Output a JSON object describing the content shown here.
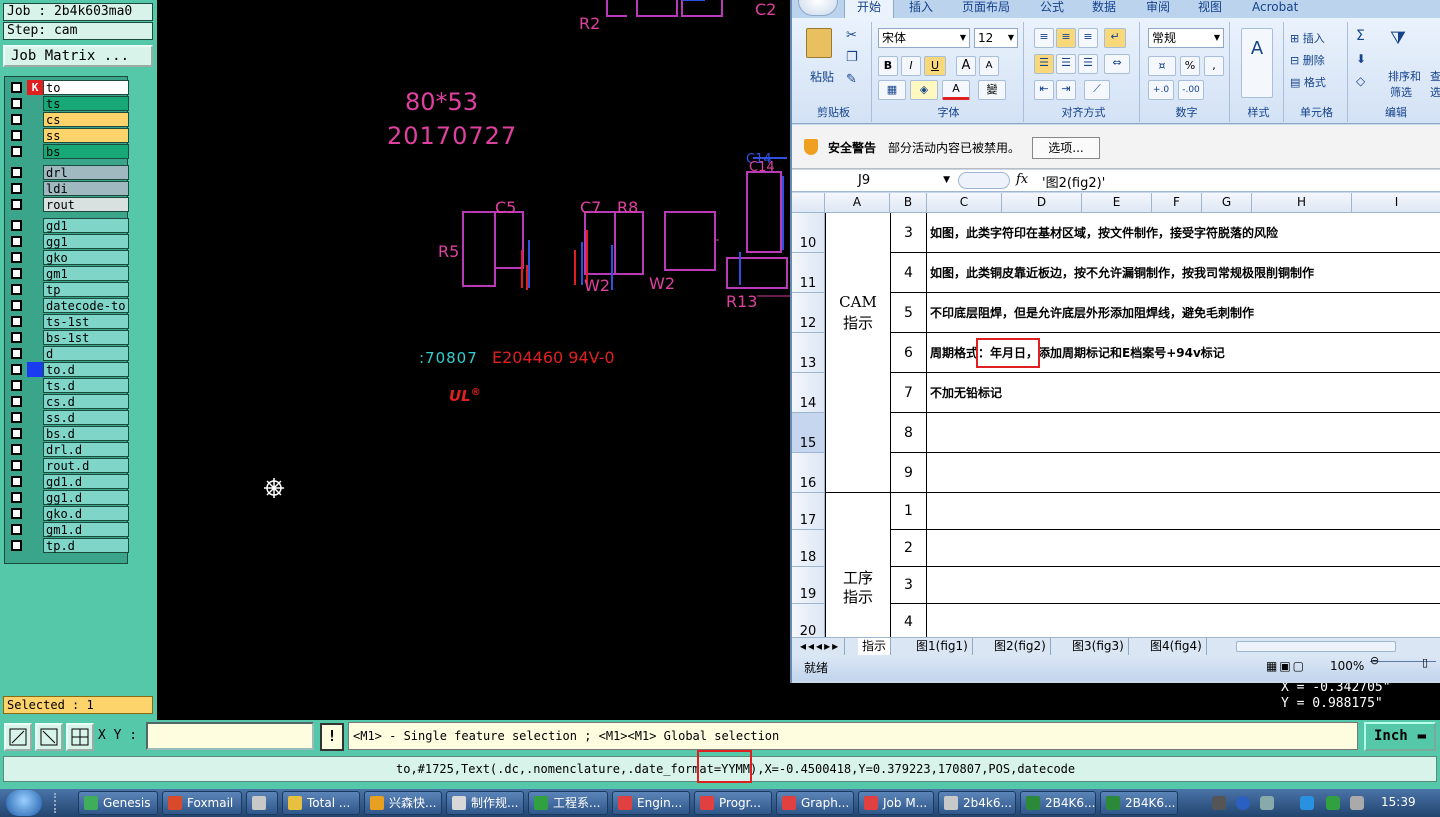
{
  "genesis": {
    "job_label": "Job : 2b4k603ma0",
    "step_label": "Step: cam",
    "job_matrix_button": "Job Matrix ...",
    "layers": [
      {
        "name": "to",
        "color": "#ffffff",
        "tag": "red-k"
      },
      {
        "name": "ts",
        "color": "#18a878"
      },
      {
        "name": "cs",
        "color": "#fdd36b"
      },
      {
        "name": "ss",
        "color": "#fdd36b"
      },
      {
        "name": "bs",
        "color": "#18a878"
      },
      {
        "name": "drl",
        "color": "#a0b8c0"
      },
      {
        "name": "ldi",
        "color": "#a0b8c0"
      },
      {
        "name": "rout",
        "color": "#d8e0e0"
      },
      {
        "name": "gd1",
        "color": "#7fd6c8"
      },
      {
        "name": "gg1",
        "color": "#7fd6c8"
      },
      {
        "name": "gko",
        "color": "#7fd6c8"
      },
      {
        "name": "gm1",
        "color": "#7fd6c8"
      },
      {
        "name": "tp",
        "color": "#7fd6c8"
      },
      {
        "name": "datecode-to",
        "color": "#7fd6c8"
      },
      {
        "name": "ts-1st",
        "color": "#7fd6c8"
      },
      {
        "name": "bs-1st",
        "color": "#7fd6c8"
      },
      {
        "name": "d",
        "color": "#7fd6c8"
      },
      {
        "name": "to.d",
        "color": "#7fd6c8",
        "tag": "blue"
      },
      {
        "name": "ts.d",
        "color": "#7fd6c8"
      },
      {
        "name": "cs.d",
        "color": "#7fd6c8"
      },
      {
        "name": "ss.d",
        "color": "#7fd6c8"
      },
      {
        "name": "bs.d",
        "color": "#7fd6c8"
      },
      {
        "name": "drl.d",
        "color": "#7fd6c8"
      },
      {
        "name": "rout.d",
        "color": "#7fd6c8"
      },
      {
        "name": "gd1.d",
        "color": "#7fd6c8"
      },
      {
        "name": "gg1.d",
        "color": "#7fd6c8"
      },
      {
        "name": "gko.d",
        "color": "#7fd6c8"
      },
      {
        "name": "gm1.d",
        "color": "#7fd6c8"
      },
      {
        "name": "tp.d",
        "color": "#7fd6c8"
      }
    ],
    "selected_label": "Selected : 1",
    "canvas": {
      "size_text": "80*53",
      "date_text": "20170727",
      "ref_labels": [
        "R2",
        "C2",
        "C5",
        "C7",
        "R8",
        "R5",
        "C14",
        "C14",
        "W2",
        "W2",
        "R13"
      ],
      "datecode_text": ":70807",
      "ul_text": "E204460 94V-0",
      "ul_mark": "UL",
      "registered_mark": "®"
    },
    "coord_x": "X = -0.342705\"",
    "coord_y": "Y =  0.988175\"",
    "xy_label": "X Y :",
    "xy_value": "",
    "warn_symbol": "!",
    "hint_text": "<M1> - Single feature selection ; <M1><M1> Global selection",
    "unit": "Inch",
    "status_text": "to,#1725,Text(.dc,.nomenclature,.date_format=YYMM),X=-0.4500418,Y=0.379223,170807,POS,datecode"
  },
  "excel": {
    "tabs": [
      "开始",
      "插入",
      "页面布局",
      "公式",
      "数据",
      "审阅",
      "视图",
      "Acrobat"
    ],
    "clipboard": {
      "paste": "粘贴",
      "label": "剪贴板"
    },
    "font": {
      "name": "宋体",
      "size": "12",
      "label": "字体",
      "bold": "B",
      "italic": "I",
      "underline": "U",
      "grow": "A",
      "shrink": "A",
      "font_color": "A",
      "phonetic": "變"
    },
    "alignment": {
      "label": "对齐方式"
    },
    "number": {
      "format": "常规",
      "label": "数字",
      "percent": "%",
      "comma": ","
    },
    "styles": {
      "label": "样式"
    },
    "cells": {
      "insert": "插入",
      "delete": "删除",
      "format": "格式",
      "label": "单元格"
    },
    "editing": {
      "sum": "Σ",
      "sort": "排序和",
      "filter": "筛选",
      "find": "查",
      "find2": "选",
      "label": "编辑"
    },
    "security": {
      "title": "安全警告",
      "message": "部分活动内容已被禁用。",
      "options_button": "选项..."
    },
    "name_box": "J9",
    "fx": "fx",
    "formula": "'图2(fig2)'",
    "columns": [
      "A",
      "B",
      "C",
      "D",
      "E",
      "F",
      "G",
      "H",
      "I"
    ],
    "rows": [
      {
        "num": "10",
        "no": "3",
        "text": "如图，此类字符印在基材区域，按文件制作，接受字符脱落的风险"
      },
      {
        "num": "11",
        "no": "4",
        "text": "如图，此类铜皮靠近板边，按不允许漏铜制作，按我司常规极限削铜制作"
      },
      {
        "num": "12",
        "no": "5",
        "text": "不印底层阻焊，但是允许底层外形添加阻焊线，避免毛刺制作"
      },
      {
        "num": "13",
        "no": "6",
        "text_pre": "周期格式",
        "highlight": "：年月日，",
        "text_post": "添加周期标记和E档案号+94v标记"
      },
      {
        "num": "14",
        "no": "7",
        "text": "不加无铅标记"
      },
      {
        "num": "15",
        "no": "8",
        "text": ""
      },
      {
        "num": "16",
        "no": "9",
        "text": ""
      },
      {
        "num": "17",
        "no": "1",
        "text": ""
      },
      {
        "num": "18",
        "no": "2",
        "text": ""
      },
      {
        "num": "19",
        "no": "3",
        "text": ""
      },
      {
        "num": "20",
        "no": "4",
        "text": ""
      }
    ],
    "group_cam_line1": "CAM",
    "group_cam_line2": "指示",
    "group_process_line1": "工序",
    "group_process_line2": "指示",
    "sheet_tabs": [
      "指示",
      "图1(fig1)",
      "图2(fig2)",
      "图3(fig3)",
      "图4(fig4)"
    ],
    "status_ready": "就绪",
    "zoom": "100%"
  },
  "taskbar": {
    "items": [
      {
        "label": "Genesis",
        "color": "#3fae5a"
      },
      {
        "label": "Foxmail",
        "color": "#d94a2a"
      },
      {
        "label": "",
        "color": "#c8c8c8"
      },
      {
        "label": "Total ...",
        "color": "#e8c040"
      },
      {
        "label": "兴森快...",
        "color": "#e8a020"
      },
      {
        "label": "制作规...",
        "color": "#d8d8d8"
      },
      {
        "label": "工程系...",
        "color": "#30a040"
      },
      {
        "label": "Engin...",
        "color": "#e04040"
      },
      {
        "label": "Progr...",
        "color": "#e04040"
      },
      {
        "label": "Graph...",
        "color": "#e04040"
      },
      {
        "label": "Job M...",
        "color": "#e04040"
      },
      {
        "label": "2b4k6...",
        "color": "#c8c8c8"
      },
      {
        "label": "2B4K6...",
        "color": "#2a8a3a"
      },
      {
        "label": "2B4K6...",
        "color": "#2a8a3a"
      }
    ],
    "clock": "15:39"
  }
}
